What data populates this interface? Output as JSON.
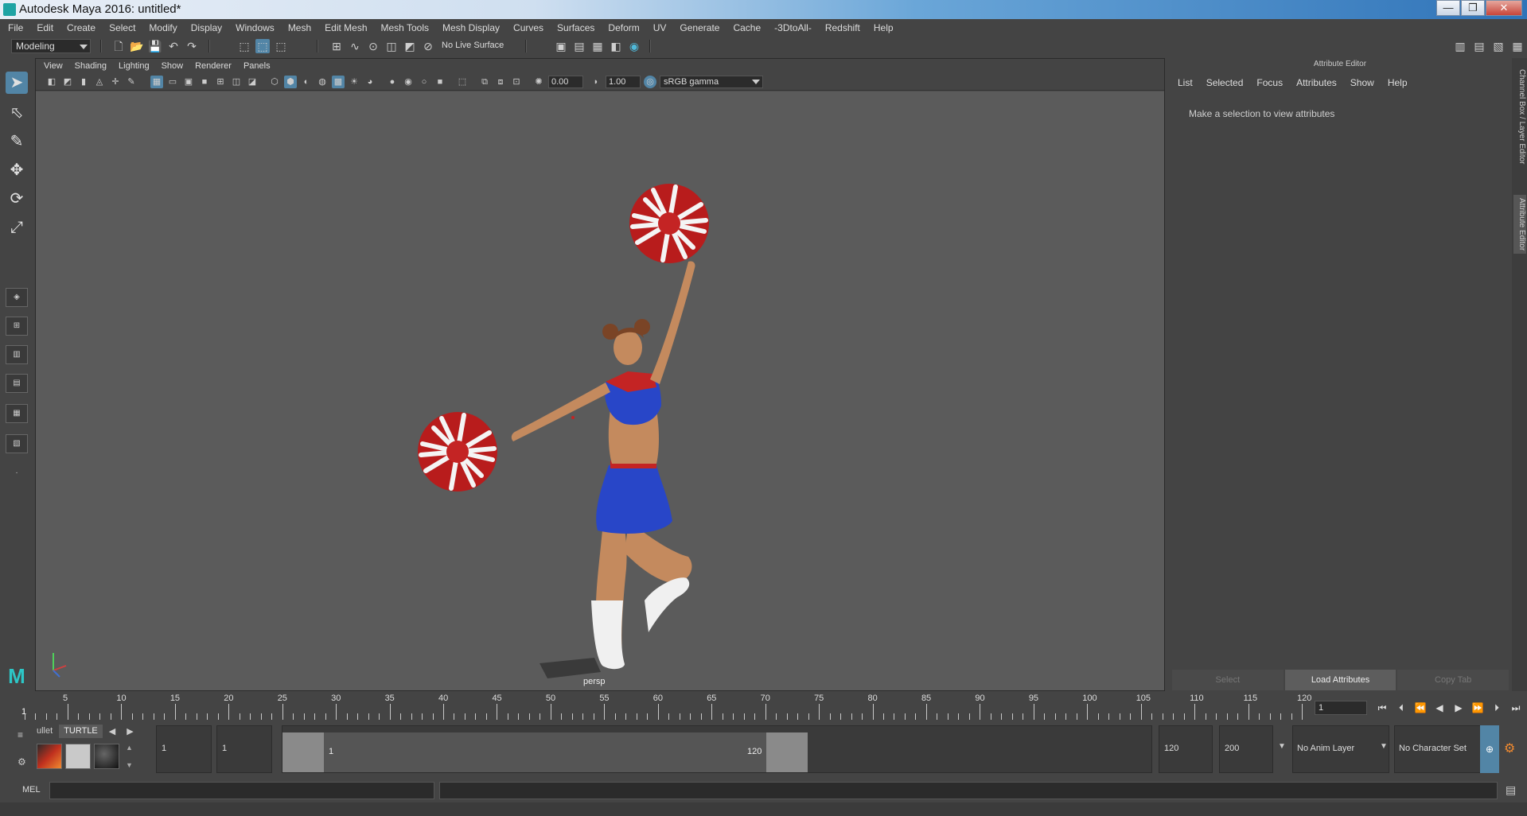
{
  "window": {
    "title": "Autodesk Maya 2016: untitled*",
    "controls": [
      "—",
      "❐",
      "✕"
    ]
  },
  "menubar": [
    "File",
    "Edit",
    "Create",
    "Select",
    "Modify",
    "Display",
    "Windows",
    "Mesh",
    "Edit Mesh",
    "Mesh Tools",
    "Mesh Display",
    "Curves",
    "Surfaces",
    "Deform",
    "UV",
    "Generate",
    "Cache",
    "-3DtoAll-",
    "Redshift",
    "Help"
  ],
  "status": {
    "mode": "Modeling",
    "live_surface": "No Live Surface"
  },
  "panel": {
    "menu": [
      "View",
      "Shading",
      "Lighting",
      "Show",
      "Renderer",
      "Panels"
    ],
    "exposure": "0.00",
    "gamma_value": "1.00",
    "color_space": "sRGB gamma",
    "camera": "persp"
  },
  "attribute_editor": {
    "title": "Attribute Editor",
    "menu": [
      "List",
      "Selected",
      "Focus",
      "Attributes",
      "Show",
      "Help"
    ],
    "message": "Make a selection to view attributes",
    "buttons": {
      "select": "Select",
      "load": "Load Attributes",
      "copy": "Copy Tab"
    },
    "side_tabs": [
      "Channel Box / Layer Editor",
      "Attribute Editor"
    ]
  },
  "timeline": {
    "labels": [
      "5",
      "10",
      "15",
      "20",
      "25",
      "30",
      "35",
      "40",
      "45",
      "50",
      "55",
      "60",
      "65",
      "70",
      "75",
      "80",
      "85",
      "90",
      "95",
      "100",
      "105",
      "110",
      "115",
      "120"
    ],
    "current_frame": "1",
    "frame_field": "1"
  },
  "shelf": {
    "tabs": [
      "ullet",
      "TURTLE"
    ]
  },
  "range": {
    "start": "1",
    "playback_start": "1",
    "slider_start": "1",
    "slider_end": "120",
    "playback_end": "120",
    "end": "200",
    "anim_layer": "No Anim Layer",
    "character_set": "No Character Set"
  },
  "command": {
    "mel_label": "MEL"
  },
  "colors": {
    "accent": "#5285a6",
    "viewport_bg": "#5b5b5b",
    "ui_bg": "#444444"
  }
}
